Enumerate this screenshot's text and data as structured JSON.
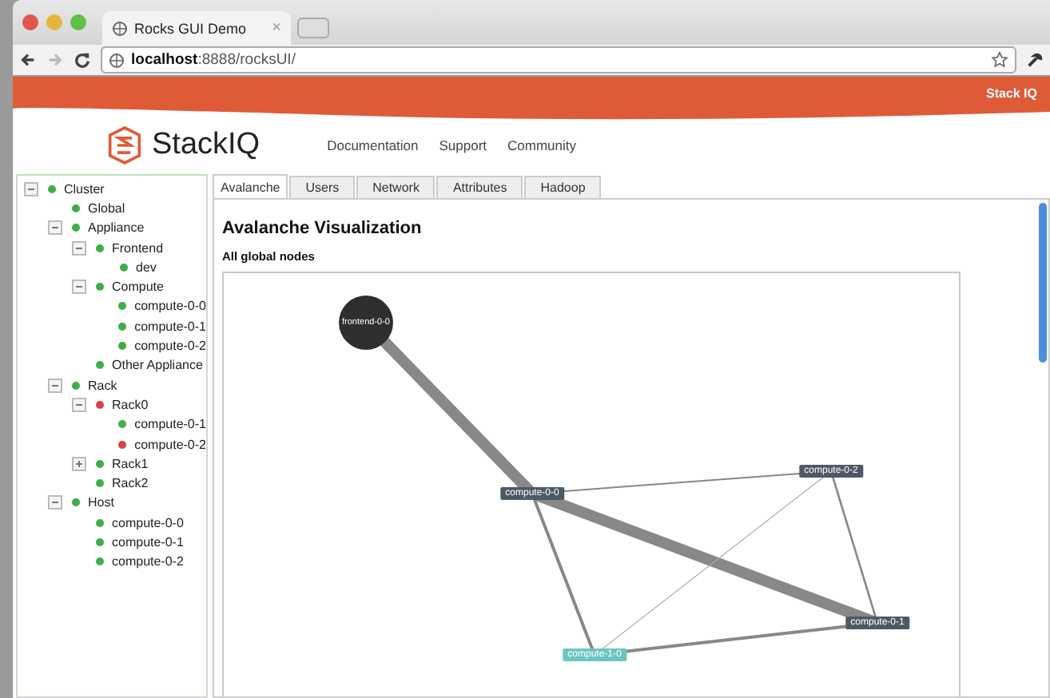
{
  "browser": {
    "tab_title": "Rocks GUI Demo",
    "tab_close": "×",
    "url_host": "localhost",
    "url_rest": ":8888/rocksUI/"
  },
  "banner": {
    "brand": "Stack IQ"
  },
  "header": {
    "logo_text": "StackIQ",
    "nav": [
      "Documentation",
      "Support",
      "Community"
    ]
  },
  "tree": [
    {
      "label": "Cluster",
      "color": "#3fae49",
      "expanded": true,
      "children": [
        {
          "label": "Global",
          "color": "#3fae49"
        },
        {
          "label": "Appliance",
          "color": "#3fae49",
          "expanded": true,
          "children": [
            {
              "label": "Frontend",
              "color": "#3fae49",
              "expanded": true,
              "children": [
                {
                  "label": "dev",
                  "color": "#3fae49"
                }
              ]
            },
            {
              "label": "Compute",
              "color": "#3fae49",
              "expanded": true,
              "children": [
                {
                  "label": "compute-0-0",
                  "color": "#3fae49"
                },
                {
                  "label": "compute-0-1",
                  "color": "#3fae49"
                },
                {
                  "label": "compute-0-2",
                  "color": "#3fae49"
                }
              ]
            },
            {
              "label": "Other Appliance",
              "color": "#3fae49"
            }
          ]
        },
        {
          "label": "Rack",
          "color": "#3fae49",
          "expanded": true,
          "children": [
            {
              "label": "Rack0",
              "color": "#d9414f",
              "expanded": true,
              "children": [
                {
                  "label": "compute-0-1",
                  "color": "#3fae49"
                },
                {
                  "label": "compute-0-2",
                  "color": "#d9414f"
                }
              ]
            },
            {
              "label": "Rack1",
              "color": "#3fae49",
              "expanded": false
            },
            {
              "label": "Rack2",
              "color": "#3fae49"
            }
          ]
        },
        {
          "label": "Host",
          "color": "#3fae49",
          "expanded": true,
          "children": [
            {
              "label": "compute-0-0",
              "color": "#3fae49"
            },
            {
              "label": "compute-0-1",
              "color": "#3fae49"
            },
            {
              "label": "compute-0-2",
              "color": "#3fae49"
            }
          ]
        }
      ]
    }
  ],
  "tabs": [
    {
      "label": "Avalanche",
      "selected": true
    },
    {
      "label": "Users",
      "selected": false
    },
    {
      "label": "Network",
      "selected": false
    },
    {
      "label": "Attributes",
      "selected": false
    },
    {
      "label": "Hadoop",
      "selected": false
    }
  ],
  "panel": {
    "title": "Avalanche Visualization",
    "subtitle": "All global nodes"
  },
  "graph": {
    "nodes": [
      {
        "label": "frontend-0-0",
        "kind": "circle",
        "color": "#2e2e2e"
      },
      {
        "label": "compute-0-0",
        "kind": "box",
        "color": "#4d5a66"
      },
      {
        "label": "compute-0-2",
        "kind": "box",
        "color": "#4d5a66"
      },
      {
        "label": "compute-0-1",
        "kind": "box",
        "color": "#4d5a66"
      },
      {
        "label": "compute-1-0",
        "kind": "box",
        "color": "#6cc6c0"
      }
    ]
  }
}
